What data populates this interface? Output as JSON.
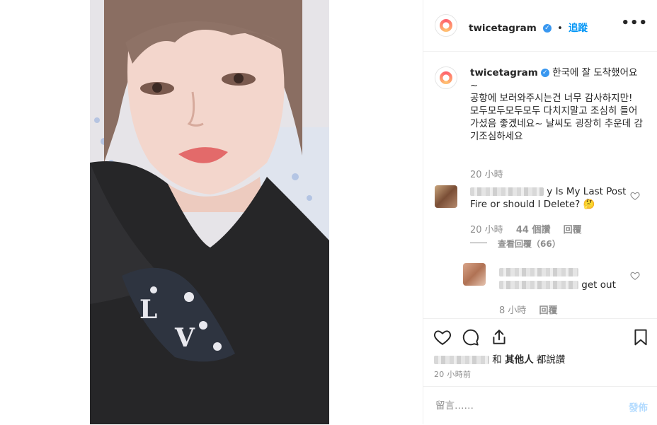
{
  "post": {
    "username": "twicetagram",
    "follow_label": "追蹤",
    "dot_sep": "•",
    "more_label": "•••"
  },
  "caption": {
    "username": "twicetagram",
    "text": "한국에 잘 도착했어요~\n공항에 보러와주시는건 너무 감사하지만!\n모두모두모두모두 다치지말고 조심히 들어가셨음 좋겠네요~ 날씨도 굉장히 추운데 감기조심하세요",
    "time": "20 小時"
  },
  "comments": [
    {
      "text": "y Is My Last Post Fire or should I Delete? 🤔",
      "time": "20 小時",
      "likes": "44 個讚",
      "reply_label": "回覆",
      "view_replies": "查看回覆（66）"
    },
    {
      "text": "get out",
      "time": "8 小時",
      "reply_label": "回覆"
    }
  ],
  "likes_line": {
    "and": "和",
    "others": "其他人",
    "suffix": "都說讚"
  },
  "posted_time": "20 小時前",
  "comment_input": {
    "placeholder": "留言……",
    "post_label": "發佈"
  },
  "icons": {
    "like": "heart-icon",
    "comment": "comment-icon",
    "share": "share-icon",
    "save": "bookmark-icon",
    "verified": "verified-badge-icon",
    "more": "more-options-icon"
  },
  "colors": {
    "accent": "#0095f6",
    "verified": "#3897f0",
    "secondary_text": "#8e8e8e",
    "post_disabled": "#b3dbff"
  }
}
